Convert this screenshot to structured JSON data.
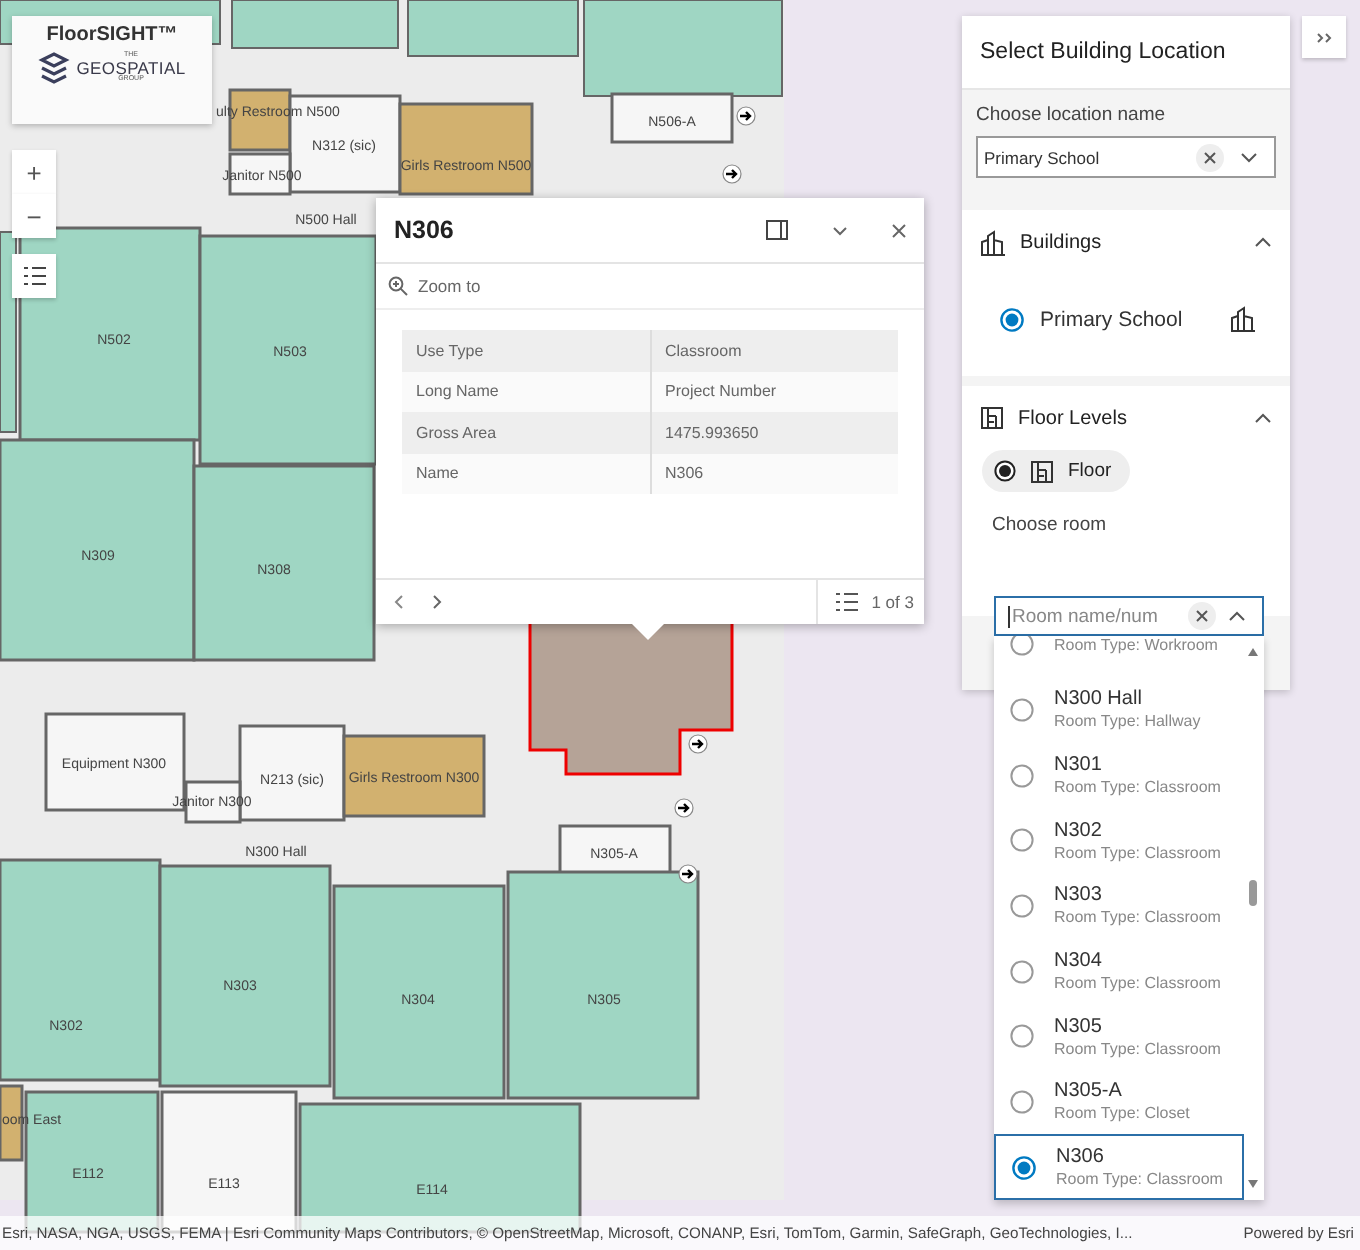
{
  "logo": {
    "title": "FloorSIGHT™",
    "tag_top": "THE",
    "brand": "GEOSPATIAL",
    "tag_bottom": "GROUP"
  },
  "map": {
    "rooms": [
      {
        "label": "ulty Restroom N500",
        "kind": "restroom"
      },
      {
        "label": "N312 (sic)",
        "kind": "other"
      },
      {
        "label": "Janitor N500",
        "kind": "other"
      },
      {
        "label": "Girls Restroom N500",
        "kind": "restroom"
      },
      {
        "label": "N506-A",
        "kind": "other"
      },
      {
        "label": "N500 Hall",
        "kind": "hall"
      },
      {
        "label": "N502",
        "kind": "classroom"
      },
      {
        "label": "N503",
        "kind": "classroom"
      },
      {
        "label": "N309",
        "kind": "classroom"
      },
      {
        "label": "N308",
        "kind": "classroom"
      },
      {
        "label": "Equipment N300",
        "kind": "other"
      },
      {
        "label": "N213 (sic)",
        "kind": "other"
      },
      {
        "label": "Janitor N300",
        "kind": "other"
      },
      {
        "label": "Girls Restroom N300",
        "kind": "restroom"
      },
      {
        "label": "N300 Hall",
        "kind": "hall"
      },
      {
        "label": "N305-A",
        "kind": "other"
      },
      {
        "label": "N302",
        "kind": "classroom"
      },
      {
        "label": "N303",
        "kind": "classroom"
      },
      {
        "label": "N304",
        "kind": "classroom"
      },
      {
        "label": "N305",
        "kind": "classroom"
      },
      {
        "label": "oom East",
        "kind": "restroom"
      },
      {
        "label": "E112",
        "kind": "classroom"
      },
      {
        "label": "E113",
        "kind": "other"
      },
      {
        "label": "E114",
        "kind": "classroom"
      }
    ]
  },
  "map_controls": {
    "zoom_in": "+",
    "zoom_out": "−"
  },
  "popup": {
    "title": "N306",
    "zoom_label": "Zoom to",
    "rows": [
      {
        "field": "Use Type",
        "value": "Classroom"
      },
      {
        "field": "Long Name",
        "value": "Project Number"
      },
      {
        "field": "Gross Area",
        "value": "1475.993650"
      },
      {
        "field": "Name",
        "value": "N306"
      }
    ],
    "page": "1 of 3"
  },
  "panel": {
    "title": "Select Building Location",
    "location_label": "Choose location name",
    "location_value": "Primary School",
    "buildings": {
      "title": "Buildings",
      "expanded": true,
      "items": [
        {
          "label": "Primary School",
          "selected": true
        }
      ]
    },
    "floor_levels": {
      "title": "Floor Levels",
      "expanded": true,
      "items": [
        {
          "label": "Floor",
          "selected": true
        }
      ]
    },
    "room_label": "Choose room",
    "room_placeholder": "Room name/num",
    "rooms": [
      {
        "type": "Room Type: Workroom",
        "selected": false
      },
      {
        "name": "N300 Hall",
        "type": "Room Type: Hallway",
        "selected": false
      },
      {
        "name": "N301",
        "type": "Room Type: Classroom",
        "selected": false
      },
      {
        "name": "N302",
        "type": "Room Type: Classroom",
        "selected": false
      },
      {
        "name": "N303",
        "type": "Room Type: Classroom",
        "selected": false
      },
      {
        "name": "N304",
        "type": "Room Type: Classroom",
        "selected": false
      },
      {
        "name": "N305",
        "type": "Room Type: Classroom",
        "selected": false
      },
      {
        "name": "N305-A",
        "type": "Room Type: Closet",
        "selected": false
      },
      {
        "name": "N306",
        "type": "Room Type: Classroom",
        "selected": true
      }
    ]
  },
  "attribution": {
    "sources": "Esri, NASA, NGA, USGS, FEMA | Esri Community Maps Contributors, © OpenStreetMap, Microsoft, CONANP, Esri, TomTom, Garmin, SafeGraph, GeoTechnologies, I...",
    "powered": "Powered by Esri"
  }
}
